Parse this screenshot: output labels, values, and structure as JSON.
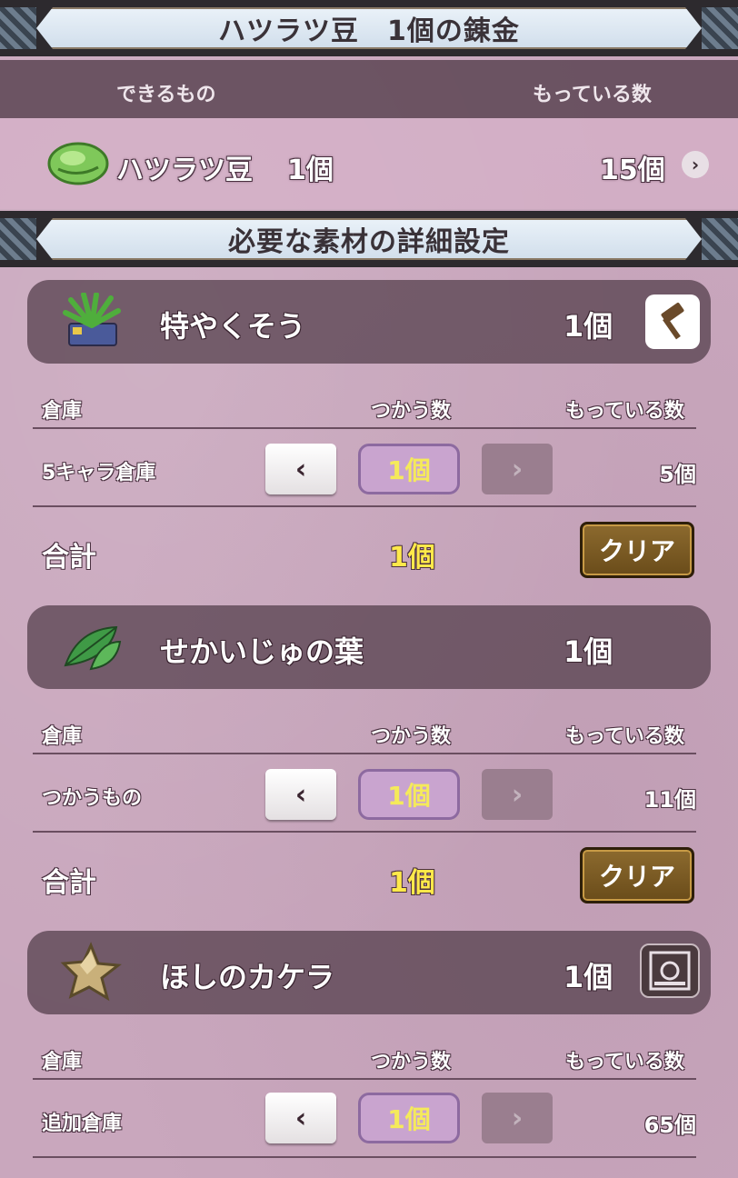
{
  "banners": {
    "top": "ハツラツ豆　1個の錬金",
    "materials": "必要な素材の詳細設定"
  },
  "product_header": {
    "left": "できるもの",
    "right": "もっている数"
  },
  "product": {
    "name": "ハツラツ豆",
    "count": "1個",
    "owned": "15個",
    "icon": "green-bean-icon"
  },
  "materials": [
    {
      "name": "特やくそう",
      "count": "1個",
      "icon": "herb-icon",
      "action_icon": "hammer-icon",
      "col_storage": "倉庫",
      "col_use": "つかう数",
      "col_owned": "もっている数",
      "storage": "5キャラ倉庫",
      "use": "1個",
      "owned": "5個",
      "total_label": "合計",
      "total": "1個",
      "clear": "クリア"
    },
    {
      "name": "せかいじゅの葉",
      "count": "1個",
      "icon": "leaf-icon",
      "col_storage": "倉庫",
      "col_use": "つかう数",
      "col_owned": "もっている数",
      "storage": "つかうもの",
      "use": "1個",
      "owned": "11個",
      "total_label": "合計",
      "total": "1個",
      "clear": "クリア"
    },
    {
      "name": "ほしのカケラ",
      "count": "1個",
      "icon": "star-fragment-icon",
      "action_icon": "shop-icon",
      "col_storage": "倉庫",
      "col_use": "つかう数",
      "col_owned": "もっている数",
      "storage": "追加倉庫",
      "use": "1個",
      "owned": "65個"
    }
  ],
  "symbols": {
    "left": "‹",
    "right": "›"
  },
  "colors": {
    "background": "#c9a7bd",
    "quantity_text": "#f5ea5a",
    "clear_button": "#7a5a24"
  }
}
